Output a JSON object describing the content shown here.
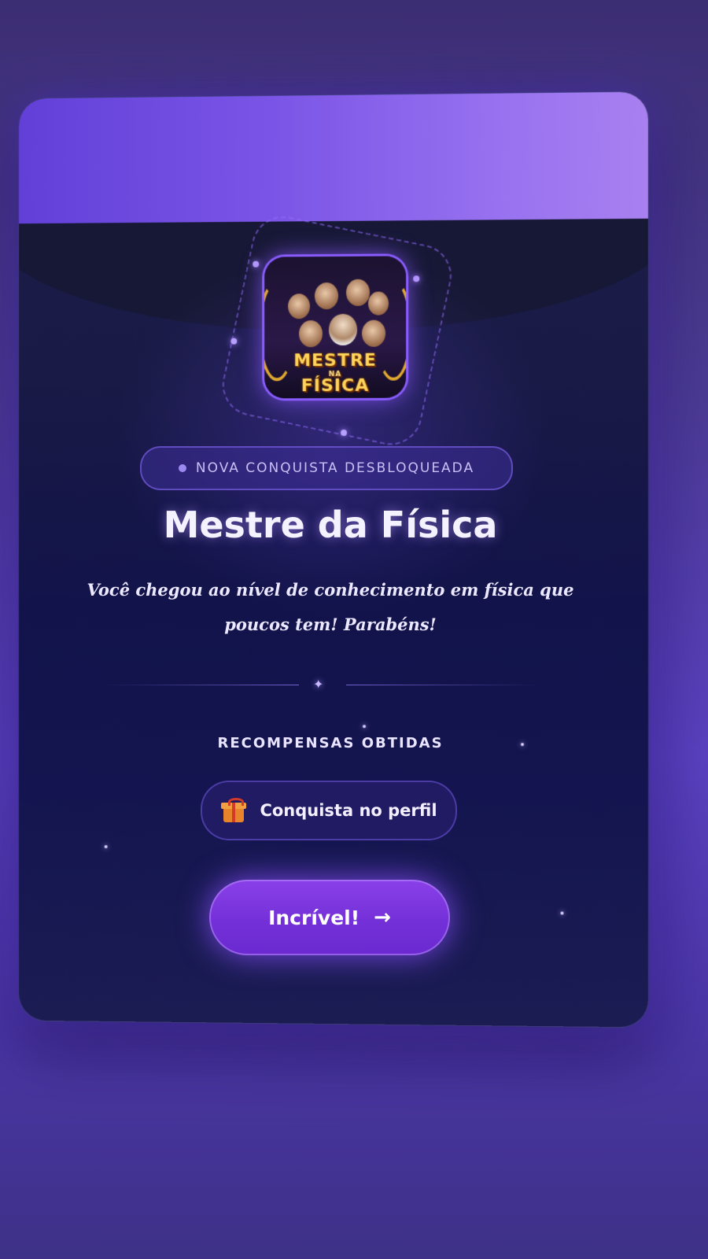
{
  "achievement": {
    "badge_emblem_line1": "MESTRE",
    "badge_emblem_line2": "NA",
    "badge_emblem_line3": "FÍSICA",
    "status_pill": "NOVA CONQUISTA DESBLOQUEADA",
    "title": "Mestre da Física",
    "description": "Você chegou ao nível de conhecimento em física que poucos tem! Parabéns!"
  },
  "rewards": {
    "label": "RECOMPENSAS OBTIDAS",
    "items": [
      {
        "icon": "gift-icon",
        "label": "Conquista no perfil"
      }
    ]
  },
  "cta": {
    "label": "Incrível!",
    "arrow": "→"
  },
  "colors": {
    "accent": "#7a36e0",
    "card_background": "#171840",
    "title_text": "#f5f2ff"
  }
}
